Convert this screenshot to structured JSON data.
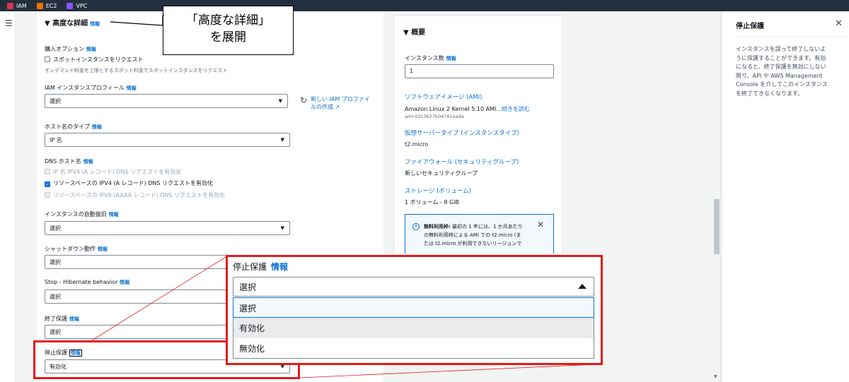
{
  "topbar": {
    "services": [
      {
        "label": "IAM",
        "color": "#dd344c"
      },
      {
        "label": "EC2",
        "color": "#ed7100"
      },
      {
        "label": "VPC",
        "color": "#8c4fff"
      }
    ]
  },
  "advanced": {
    "header": "高度な詳細",
    "info": "情報",
    "purchase": {
      "label": "購入オプション",
      "info": "情報",
      "checkbox": "スポットインスタンスをリクエスト",
      "desc": "オンデマンド料金を上限とするスポット料金でスポットインスタンスをリクエスト"
    },
    "iam": {
      "label": "IAM インスタンスプロフィール",
      "info": "情報",
      "value": "選択",
      "new_link_1": "新しい IAM プロファイ",
      "new_link_2": "ルの作成"
    },
    "hostname": {
      "label": "ホスト名のタイプ",
      "info": "情報",
      "value": "IP 名"
    },
    "dns": {
      "label": "DNS ホスト名",
      "info": "情報",
      "opt1": "IP 名 IPV4 (A レコード) DNS リクエストを有効化",
      "opt2": "リソースベースの IPV4 (A レコード) DNS リクエストを有効化",
      "opt3": "リソースベースの IPV6 (AAAA レコード) DNS リクエストを有効化"
    },
    "recovery": {
      "label": "インスタンスの自動復旧",
      "info": "情報",
      "value": "選択"
    },
    "shutdown": {
      "label": "シャットダウン動作",
      "info": "情報",
      "value": "選択"
    },
    "hibernate": {
      "label": "Stop - Hibernate behavior",
      "info": "情報",
      "value": "選択"
    },
    "termination": {
      "label": "終了保護",
      "info": "情報",
      "value": "選択"
    },
    "stop": {
      "label": "停止保護",
      "info": "情報",
      "value": "有効化"
    }
  },
  "callout": {
    "line1": "「高度な詳細」",
    "line2": "を展開"
  },
  "summary": {
    "title": "概要",
    "count_label": "インスタンス数",
    "count_info": "情報",
    "count_value": "1",
    "ami_label": "ソフトウェアイメージ (AMI)",
    "ami_value": "Amazon Linux 2 Kernel 5.10 AMI...",
    "ami_more": "続きを読む",
    "ami_id": "ami-02c3627b04781eada",
    "type_label": "仮想サーバータイプ (インスタンスタイプ)",
    "type_value": "t2.micro",
    "fw_label": "ファイアウォール (セキュリティグループ)",
    "fw_value": "新しいセキュリティグループ",
    "storage_label": "ストレージ (ボリューム)",
    "storage_value": "1 ボリューム - 8 GiB",
    "free_tier_bold": "無料利用枠:",
    "free_tier_1": " 最初の 1 年には、1 か月あたり",
    "free_tier_2": "の無料利用枠による AMI での t2.micro (ま",
    "free_tier_3": "たは t2.micro が利用できないリージョンで"
  },
  "help": {
    "title": "停止保護",
    "body": [
      "インスタンスを誤って終了しないよ",
      "うに保護することができます。有効",
      "になると、終了保護を無効にしない",
      "限り、API や AWS Management",
      "Console を介してこのインスタンス",
      "を終了できなくなります。"
    ]
  },
  "zoom": {
    "label": "停止保護",
    "info": "情報",
    "value": "選択",
    "options": [
      "選択",
      "有効化",
      "無効化"
    ]
  },
  "colors": {
    "accent": "#0972d3",
    "highlight": "#e41b1b",
    "nav": "#232f3e"
  }
}
